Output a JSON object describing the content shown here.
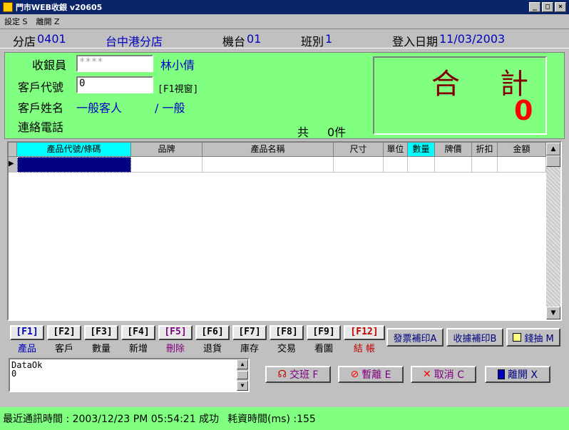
{
  "window": {
    "title": "門市WEB收銀 v20605",
    "min": "_",
    "max": "□",
    "close": "×"
  },
  "menu": [
    "設定 S",
    "離開 Z"
  ],
  "info": {
    "branch_label": "分店",
    "branch_no": "0401",
    "branch_name": "台中港分店",
    "terminal_label": "機台",
    "terminal_no": "01",
    "shift_label": "班別",
    "shift_no": "1",
    "login_label": "登入日期",
    "login_date": "11/03/2003"
  },
  "form": {
    "cashier_label": "收銀員",
    "cashier_value": "****",
    "cashier_name": "林小倩",
    "cust_id_label": "客戶代號",
    "cust_id_value": "0",
    "cust_id_hint": "[F1視窗]",
    "cust_name_label": "客戶姓名",
    "cust_name_value": "一般客人",
    "cust_type": "/ 一般",
    "phone_label": "連絡電話",
    "count_prefix": "共",
    "count_value": "0件"
  },
  "total": {
    "label_a": "合",
    "label_b": "計",
    "amount": "0"
  },
  "grid": {
    "columns": [
      "產品代號/條碼",
      "品牌",
      "產品名稱",
      "尺寸",
      "單位",
      "數量",
      "牌價",
      "折扣",
      "金額"
    ],
    "row_indicator": "▶"
  },
  "fkeys": [
    {
      "key": "[F1]",
      "label": "產品",
      "color": "#0000c0"
    },
    {
      "key": "[F2]",
      "label": "客戶",
      "color": "#000000"
    },
    {
      "key": "[F3]",
      "label": "數量",
      "color": "#000000"
    },
    {
      "key": "[F4]",
      "label": "新增",
      "color": "#000000"
    },
    {
      "key": "[F5]",
      "label": "刪除",
      "color": "#800080"
    },
    {
      "key": "[F6]",
      "label": "退貨",
      "color": "#000000"
    },
    {
      "key": "[F7]",
      "label": "庫存",
      "color": "#000000"
    },
    {
      "key": "[F8]",
      "label": "交易",
      "color": "#000000"
    },
    {
      "key": "[F9]",
      "label": "看圖",
      "color": "#000000"
    },
    {
      "key": "[F12]",
      "label": "結 帳",
      "color": "#c00000"
    }
  ],
  "side_buttons": {
    "invoice": "發票補印A",
    "receipt": "收據補印B",
    "drawer": "錢抽 M"
  },
  "message": {
    "line1": "DataOk",
    "line2": "0"
  },
  "actions": {
    "shift": "交班 F",
    "pause": "暫離 E",
    "cancel": "取消 C",
    "leave": "離開 X"
  },
  "status": {
    "last_comm": "最近通訊時間 : 2003/12/23 PM 05:54:21 成功",
    "elapsed": "耗資時間(ms) :155"
  }
}
